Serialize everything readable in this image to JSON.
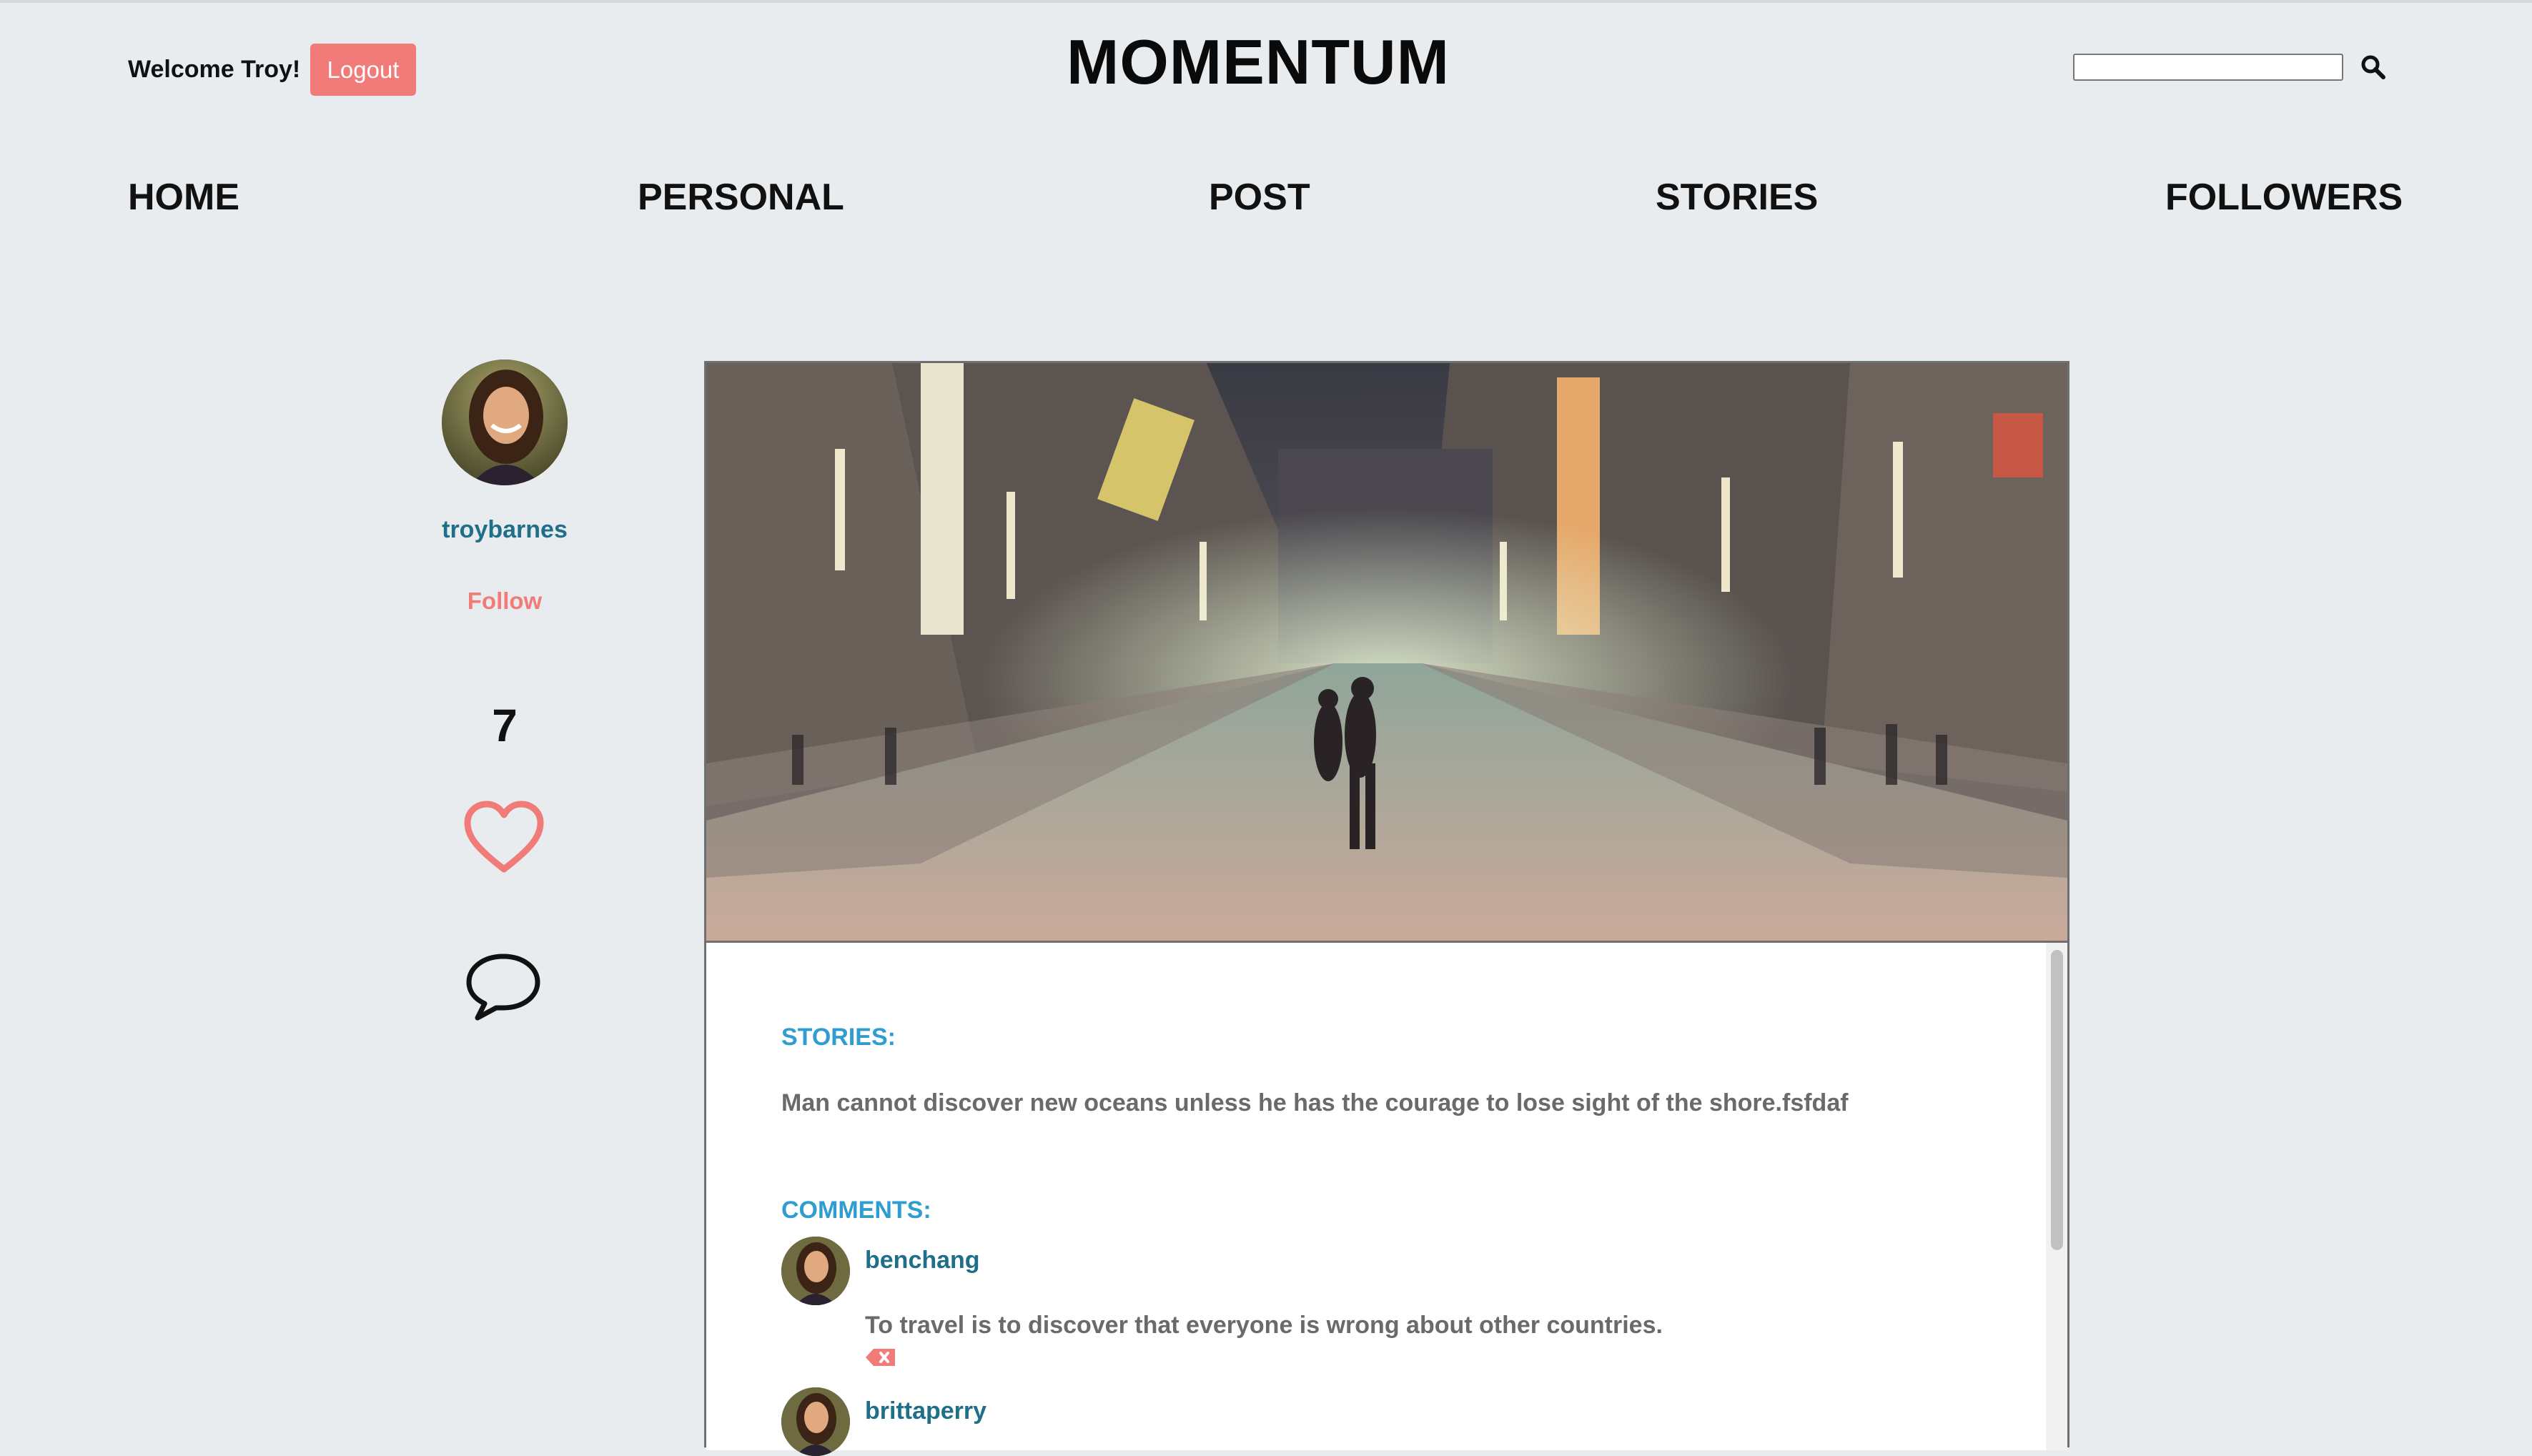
{
  "header": {
    "welcome": "Welcome Troy!",
    "logout_label": "Logout",
    "brand": "MOMENTUM",
    "search_placeholder": ""
  },
  "nav": [
    "HOME",
    "PERSONAL",
    "POST",
    "STORIES",
    "FOLLOWERS"
  ],
  "profile": {
    "username": "troybarnes",
    "follow_label": "Follow",
    "like_count": "7"
  },
  "post": {
    "stories_label": "STORIES:",
    "story_text": "Man cannot discover new oceans unless he has the courage to lose sight of the shore.fsfdaf",
    "comments_label": "COMMENTS:",
    "comments": [
      {
        "user": "benchang",
        "text": "To travel is to discover that everyone is wrong about other countries."
      },
      {
        "user": "brittaperry",
        "text": ""
      }
    ]
  },
  "colors": {
    "background": "#e9ecee",
    "accent_pink": "#f07b79",
    "link_blue": "#1f6f8b",
    "label_blue": "#2f9dd0"
  },
  "icons": [
    "search-icon",
    "heart-icon",
    "comment-bubble-icon",
    "delete-comment-icon"
  ]
}
